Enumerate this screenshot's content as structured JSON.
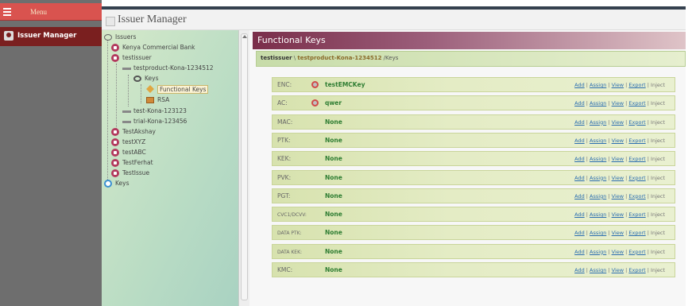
{
  "sidebar": {
    "menu_label": "Menu",
    "item_label": "Issuer Manager"
  },
  "header": {
    "title": "Issuer Manager"
  },
  "tree": {
    "root": "Issuers",
    "nodes": [
      "Kenya Commercial Bank",
      "testissuer",
      "testproduct-Kona-1234512",
      "Keys",
      "Functional Keys",
      "RSA",
      "test-Kona-123123",
      "trial-Kona-123456",
      "TestAkshay",
      "testXYZ",
      "testABC",
      "TestFerhat",
      "TestIssue",
      "Keys"
    ]
  },
  "panel": {
    "title": "Functional Keys",
    "breadcrumb": {
      "issuer": "testissuer",
      "sep": " \\ ",
      "product": "testproduct-Kona-1234512",
      "tail": " /Keys"
    }
  },
  "actions": {
    "add": "Add",
    "assign": "Assign",
    "view": "View",
    "export": "Export",
    "inject": "Inject",
    "sep": " | "
  },
  "keys": [
    {
      "name": "ENC:",
      "value": "testEMCKey"
    },
    {
      "name": "AC:",
      "value": "qwer"
    },
    {
      "name": "MAC:",
      "value": "None"
    },
    {
      "name": "PTK:",
      "value": "None"
    },
    {
      "name": "KEK:",
      "value": "None"
    },
    {
      "name": "PVK:",
      "value": "None"
    },
    {
      "name": "PGT:",
      "value": "None"
    },
    {
      "name": "CVC1/DCVV:",
      "value": "None"
    },
    {
      "name": "DATA PTK:",
      "value": "None"
    },
    {
      "name": "DATA KEK:",
      "value": "None"
    },
    {
      "name": "KMC:",
      "value": "None"
    }
  ]
}
